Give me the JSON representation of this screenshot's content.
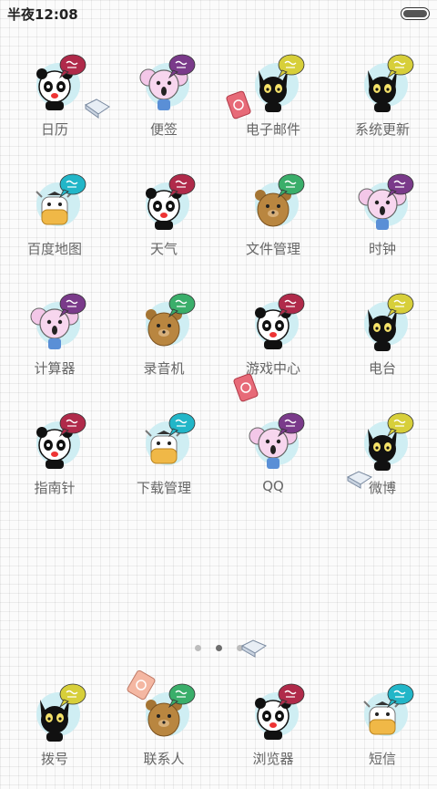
{
  "status_bar": {
    "time": "半夜12:08"
  },
  "apps": [
    {
      "label": "日历",
      "character": "panda",
      "bubble": "#b02a4a",
      "bubble_text": "日历"
    },
    {
      "label": "便签",
      "character": "koala",
      "bubble": "#7a3a8a",
      "bubble_text": "便签"
    },
    {
      "label": "电子邮件",
      "character": "cat",
      "bubble": "#d7cf3a",
      "bubble_text": "电子邮件"
    },
    {
      "label": "系统更新",
      "character": "cat",
      "bubble": "#d7cf3a",
      "bubble_text": "系统更新"
    },
    {
      "label": "百度地图",
      "character": "cow",
      "bubble": "#22b6c8",
      "bubble_text": "百度地图"
    },
    {
      "label": "天气",
      "character": "panda",
      "bubble": "#b02a4a",
      "bubble_text": "天气"
    },
    {
      "label": "文件管理",
      "character": "bear",
      "bubble": "#3aae6a",
      "bubble_text": "文件管理"
    },
    {
      "label": "时钟",
      "character": "koala",
      "bubble": "#7a3a8a",
      "bubble_text": "时钟"
    },
    {
      "label": "计算器",
      "character": "koala",
      "bubble": "#7a3a8a",
      "bubble_text": "计算器"
    },
    {
      "label": "录音机",
      "character": "bear",
      "bubble": "#3aae6a",
      "bubble_text": "录音机"
    },
    {
      "label": "游戏中心",
      "character": "panda",
      "bubble": "#b02a4a",
      "bubble_text": "游戏中心"
    },
    {
      "label": "电台",
      "character": "cat",
      "bubble": "#d7cf3a",
      "bubble_text": "电台"
    },
    {
      "label": "指南针",
      "character": "panda",
      "bubble": "#b02a4a",
      "bubble_text": "指南针"
    },
    {
      "label": "下载管理",
      "character": "cow",
      "bubble": "#22b6c8",
      "bubble_text": "下载管理"
    },
    {
      "label": "QQ",
      "character": "koala",
      "bubble": "#7a3a8a",
      "bubble_text": "QQ"
    },
    {
      "label": "微博",
      "character": "cat",
      "bubble": "#d7cf3a",
      "bubble_text": "微博"
    }
  ],
  "dock": [
    {
      "label": "拨号",
      "character": "cat",
      "bubble": "#d7cf3a",
      "bubble_text": "拨号"
    },
    {
      "label": "联系人",
      "character": "bear",
      "bubble": "#3aae6a",
      "bubble_text": "联系人"
    },
    {
      "label": "浏览器",
      "character": "panda",
      "bubble": "#b02a4a",
      "bubble_text": "浏览器"
    },
    {
      "label": "短信",
      "character": "cow",
      "bubble": "#22b6c8",
      "bubble_text": "短信"
    }
  ],
  "page_indicator": {
    "count": 3,
    "active_index": 1
  }
}
